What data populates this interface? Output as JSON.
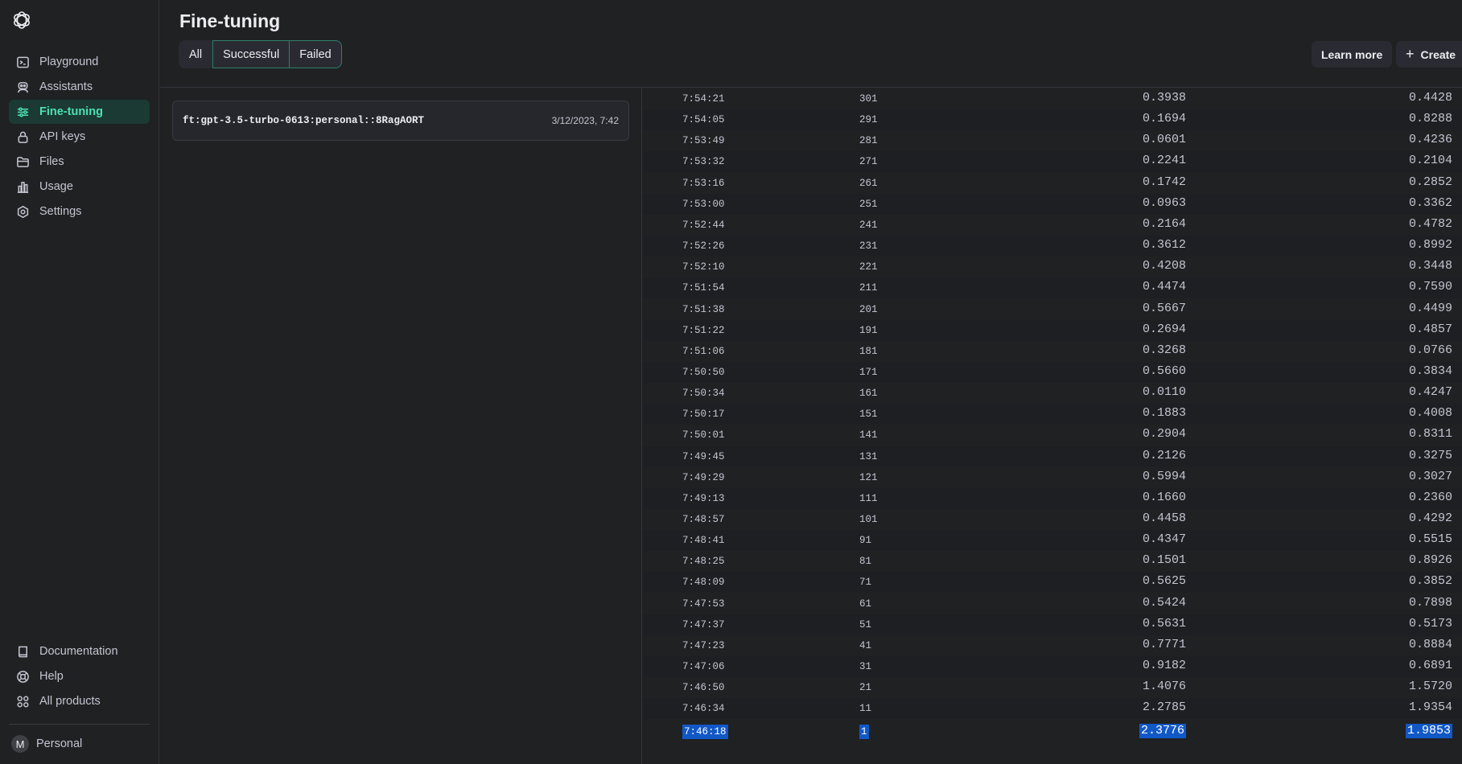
{
  "sidebar": {
    "logo": "openai-logo",
    "items": [
      {
        "label": "Playground",
        "icon": "terminal-icon"
      },
      {
        "label": "Assistants",
        "icon": "robot-icon"
      },
      {
        "label": "Fine-tuning",
        "icon": "sliders-icon",
        "active": true
      },
      {
        "label": "API keys",
        "icon": "lock-icon"
      },
      {
        "label": "Files",
        "icon": "folder-icon"
      },
      {
        "label": "Usage",
        "icon": "bar-chart-icon"
      },
      {
        "label": "Settings",
        "icon": "gear-icon"
      }
    ],
    "bottom_items": [
      {
        "label": "Documentation",
        "icon": "book-icon"
      },
      {
        "label": "Help",
        "icon": "lifebuoy-icon"
      },
      {
        "label": "All products",
        "icon": "grid-icon"
      }
    ],
    "account": {
      "initial": "M",
      "label": "Personal"
    }
  },
  "header": {
    "title": "Fine-tuning",
    "filters": [
      "All",
      "Successful",
      "Failed"
    ],
    "learn_more": "Learn more",
    "create": "Create",
    "create_icon": "+"
  },
  "jobs": [
    {
      "name": "ft:gpt-3.5-turbo-0613:personal::8RagAORT",
      "date": "3/12/2023, 7:42"
    }
  ],
  "metrics": {
    "rows": [
      {
        "time": "7:54:21",
        "step": "301",
        "loss": "0.3938",
        "acc": "0.4428"
      },
      {
        "time": "7:54:05",
        "step": "291",
        "loss": "0.1694",
        "acc": "0.8288"
      },
      {
        "time": "7:53:49",
        "step": "281",
        "loss": "0.0601",
        "acc": "0.4236"
      },
      {
        "time": "7:53:32",
        "step": "271",
        "loss": "0.2241",
        "acc": "0.2104"
      },
      {
        "time": "7:53:16",
        "step": "261",
        "loss": "0.1742",
        "acc": "0.2852"
      },
      {
        "time": "7:53:00",
        "step": "251",
        "loss": "0.0963",
        "acc": "0.3362"
      },
      {
        "time": "7:52:44",
        "step": "241",
        "loss": "0.2164",
        "acc": "0.4782"
      },
      {
        "time": "7:52:26",
        "step": "231",
        "loss": "0.3612",
        "acc": "0.8992"
      },
      {
        "time": "7:52:10",
        "step": "221",
        "loss": "0.4208",
        "acc": "0.3448"
      },
      {
        "time": "7:51:54",
        "step": "211",
        "loss": "0.4474",
        "acc": "0.7590"
      },
      {
        "time": "7:51:38",
        "step": "201",
        "loss": "0.5667",
        "acc": "0.4499"
      },
      {
        "time": "7:51:22",
        "step": "191",
        "loss": "0.2694",
        "acc": "0.4857"
      },
      {
        "time": "7:51:06",
        "step": "181",
        "loss": "0.3268",
        "acc": "0.0766"
      },
      {
        "time": "7:50:50",
        "step": "171",
        "loss": "0.5660",
        "acc": "0.3834"
      },
      {
        "time": "7:50:34",
        "step": "161",
        "loss": "0.0110",
        "acc": "0.4247"
      },
      {
        "time": "7:50:17",
        "step": "151",
        "loss": "0.1883",
        "acc": "0.4008"
      },
      {
        "time": "7:50:01",
        "step": "141",
        "loss": "0.2904",
        "acc": "0.8311"
      },
      {
        "time": "7:49:45",
        "step": "131",
        "loss": "0.2126",
        "acc": "0.3275"
      },
      {
        "time": "7:49:29",
        "step": "121",
        "loss": "0.5994",
        "acc": "0.3027"
      },
      {
        "time": "7:49:13",
        "step": "111",
        "loss": "0.1660",
        "acc": "0.2360"
      },
      {
        "time": "7:48:57",
        "step": "101",
        "loss": "0.4458",
        "acc": "0.4292"
      },
      {
        "time": "7:48:41",
        "step": "91",
        "loss": "0.4347",
        "acc": "0.5515"
      },
      {
        "time": "7:48:25",
        "step": "81",
        "loss": "0.1501",
        "acc": "0.8926"
      },
      {
        "time": "7:48:09",
        "step": "71",
        "loss": "0.5625",
        "acc": "0.3852"
      },
      {
        "time": "7:47:53",
        "step": "61",
        "loss": "0.5424",
        "acc": "0.7898"
      },
      {
        "time": "7:47:37",
        "step": "51",
        "loss": "0.5631",
        "acc": "0.5173"
      },
      {
        "time": "7:47:23",
        "step": "41",
        "loss": "0.7771",
        "acc": "0.8884"
      },
      {
        "time": "7:47:06",
        "step": "31",
        "loss": "0.9182",
        "acc": "0.6891"
      },
      {
        "time": "7:46:50",
        "step": "21",
        "loss": "1.4076",
        "acc": "1.5720"
      },
      {
        "time": "7:46:34",
        "step": "11",
        "loss": "2.2785",
        "acc": "1.9354"
      },
      {
        "time": "7:46:18",
        "step": "1",
        "loss": "2.3776",
        "acc": "1.9853",
        "selected": true
      }
    ]
  }
}
